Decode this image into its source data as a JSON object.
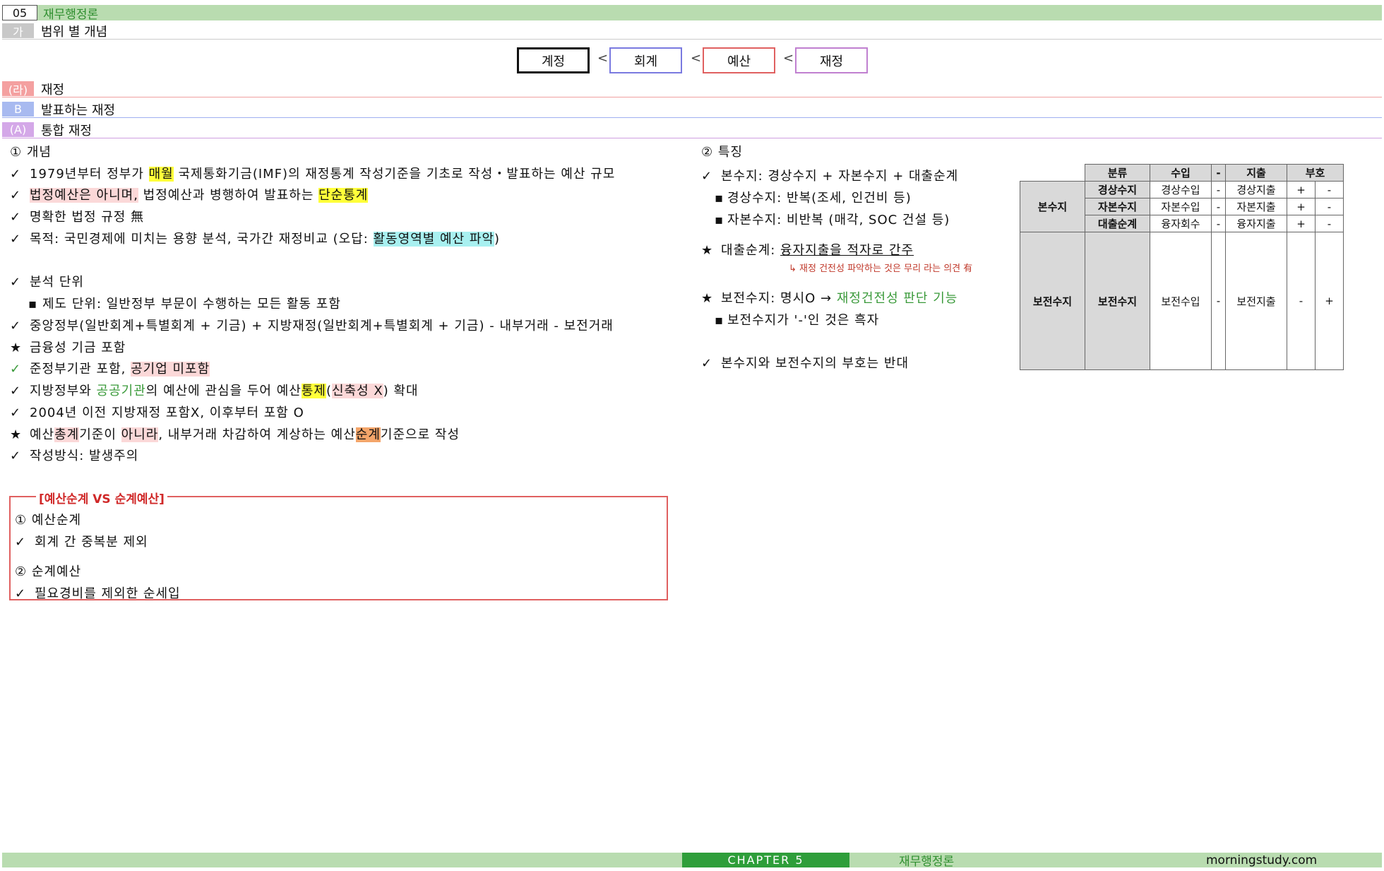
{
  "header": {
    "chapter_num": "05",
    "chapter_title": "재무행정론"
  },
  "section_ga": {
    "tag": "가",
    "title": "범위 별 개념"
  },
  "hierarchy": {
    "b1": "계정",
    "b2": "회계",
    "b3": "예산",
    "b4": "재정",
    "sep": "<"
  },
  "sections": [
    {
      "tag": "(라)",
      "title": "재정"
    },
    {
      "tag": "B",
      "title": "발표하는 재정"
    },
    {
      "tag": "(A)",
      "title": "통합 재정"
    }
  ],
  "left": {
    "heading": "① 개념",
    "l1": {
      "mark": "✓",
      "a": "1979년부터 정부가 ",
      "b": "매월",
      "c": " 국제통화기금(IMF)의 재정통계 작성기준을 기초로 작성・발표하는 예산 규모"
    },
    "l2": {
      "mark": "✓",
      "a": "법정예산은 아니며,",
      "b": " 법정예산과 병행하여 발표하는 ",
      "c": "단순통계"
    },
    "l3": {
      "mark": "✓",
      "a": "명확한 법정 규정 無"
    },
    "l4": {
      "mark": "✓",
      "a": "목적: 국민경제에 미치는 용향 분석, 국가간 재정비교 (오답: ",
      "b": "활동영역별 예산 파악",
      "c": ")"
    },
    "l5": {
      "mark": "✓",
      "a": "분석 단위"
    },
    "l6": {
      "mark": "▪",
      "a": "제도 단위: 일반정부 부문이 수행하는 모든 활동 포함"
    },
    "l7": {
      "mark": "✓",
      "a": "중앙정부(일반회계+특별회계 + 기금) + 지방재정(일반회계+특별회계 + 기금) - 내부거래 - 보전거래"
    },
    "l8": {
      "mark": "★",
      "a": "금융성 기금 포함"
    },
    "l9": {
      "mark": "✓",
      "a": "준정부기관 포함, ",
      "b": "공기업 미포함"
    },
    "l10": {
      "mark": "✓",
      "a": "지방정부와 ",
      "b": "공공기관",
      "c": "의 예산에 관심을 두어 예산",
      "d": "통제",
      "e": "(",
      "f": "신축성 X",
      "g": ") 확대"
    },
    "l11": {
      "mark": "✓",
      "a": "2004년 이전 지방재정 포함X, 이후부터 포함 O"
    },
    "l12": {
      "mark": "★",
      "a": "예산",
      "b": "총계",
      "c": "기준이 ",
      "d": "아니라",
      "e": ", 내부거래 차감하여 계상하는 예산",
      "f": "순계",
      "g": "기준으로 작성"
    },
    "l13": {
      "mark": "✓",
      "a": "작성방식: 발생주의"
    }
  },
  "compare": {
    "legend": "[예산순계 VS 순계예산]",
    "c1": "① 예산순계",
    "c2": {
      "mark": "✓",
      "a": "회계 간 중복분 제외"
    },
    "c3": "② 순계예산",
    "c4": {
      "mark": "✓",
      "a": "필요경비를 제외한 순세입"
    }
  },
  "right": {
    "heading": "② 특징",
    "r1": {
      "mark": "✓",
      "a": "본수지: 경상수지 + 자본수지 + 대출순계"
    },
    "r2": {
      "mark": "▪",
      "a": "경상수지: 반복(조세, 인건비 등)"
    },
    "r3": {
      "mark": "▪",
      "a": "자본수지: 비반복 (매각, SOC 건설  등)"
    },
    "r4": {
      "mark": "★",
      "a": "대출순계: ",
      "b": "융자지출을 적자로 간주"
    },
    "r5": "↳ 재정 건전성 파악하는 것은 무리 라는 의견 有",
    "r6": {
      "mark": "★",
      "a": "보전수지: 명시O → ",
      "b": "재정건전성 판단 기능"
    },
    "r7": {
      "mark": "▪",
      "a": "보전수지가 '-'인 것은 흑자"
    },
    "r8": {
      "mark": "✓",
      "a": "본수지와 보전수지의 부호는 반대"
    }
  },
  "table": {
    "headers": [
      "분류",
      "수입",
      "-",
      "지출",
      "부호"
    ],
    "group1": "본수지",
    "rows": [
      {
        "name": "경상수지",
        "income": "경상수입",
        "dash": "-",
        "expense": "경상지출",
        "s1": "+",
        "s2": "-"
      },
      {
        "name": "자본수지",
        "income": "자본수입",
        "dash": "-",
        "expense": "자본지출",
        "s1": "+",
        "s2": "-"
      },
      {
        "name": "대출순계",
        "income": "융자회수",
        "dash": "-",
        "expense": "융자지출",
        "s1": "+",
        "s2": "-"
      }
    ],
    "group2": "보전수지",
    "row2": {
      "name": "보전수지",
      "income": "보전수입",
      "dash": "-",
      "expense": "보전지출",
      "s1": "-",
      "s2": "+"
    }
  },
  "footer": {
    "chapter": "CHAPTER 5",
    "subject": "재무행정론",
    "site": "morningstudy.com"
  },
  "colors": {
    "green_bar": "#b9dcb0",
    "green_dark": "#2e9e3a",
    "red_box": "#e06060",
    "highlight_yellow": "#ffff3a"
  }
}
